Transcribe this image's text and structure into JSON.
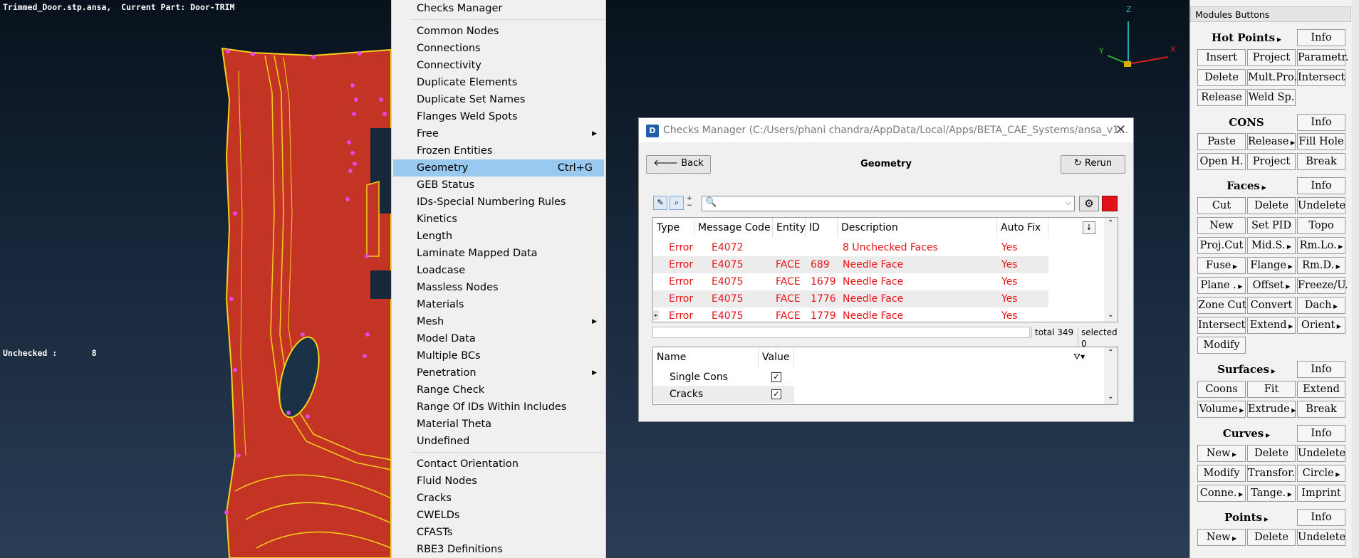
{
  "viewport": {
    "title": "Trimmed_Door.stp.ansa,  Current Part: Door-TRIM",
    "status": "Unchecked :       8",
    "axis": {
      "x": "X",
      "y": "Y",
      "z": "Z"
    }
  },
  "context_menu": {
    "items": [
      {
        "label": "Checks Manager"
      },
      {
        "separator": true
      },
      {
        "label": "Common Nodes"
      },
      {
        "label": "Connections"
      },
      {
        "label": "Connectivity"
      },
      {
        "label": "Duplicate Elements"
      },
      {
        "label": "Duplicate Set Names"
      },
      {
        "label": "Flanges Weld Spots"
      },
      {
        "label": "Free",
        "submenu": true
      },
      {
        "label": "Frozen Entities"
      },
      {
        "label": "Geometry",
        "shortcut": "Ctrl+G",
        "highlighted": true
      },
      {
        "label": "GEB Status"
      },
      {
        "label": "IDs-Special Numbering Rules"
      },
      {
        "label": "Kinetics"
      },
      {
        "label": "Length"
      },
      {
        "label": "Laminate Mapped Data"
      },
      {
        "label": "Loadcase"
      },
      {
        "label": "Massless Nodes"
      },
      {
        "label": "Materials"
      },
      {
        "label": "Mesh",
        "submenu": true
      },
      {
        "label": "Model Data"
      },
      {
        "label": "Multiple BCs"
      },
      {
        "label": "Penetration",
        "submenu": true
      },
      {
        "label": "Range Check"
      },
      {
        "label": "Range Of IDs Within Includes"
      },
      {
        "label": "Material Theta"
      },
      {
        "label": "Undefined"
      },
      {
        "separator": true
      },
      {
        "label": "Contact Orientation"
      },
      {
        "label": "Fluid Nodes"
      },
      {
        "label": "Cracks"
      },
      {
        "label": "CWELDs"
      },
      {
        "label": "CFASTs"
      },
      {
        "label": "RBE3 Definitions"
      }
    ]
  },
  "checks_dialog": {
    "title": "Checks Manager (C:/Users/phani chandra/AppData/Local/Apps/BETA_CAE_Systems/ansa_v1...",
    "logo_text": "D",
    "back_label": "Back",
    "rerun_label": "Rerun",
    "heading": "Geometry",
    "filter_value": "",
    "columns": [
      "Type",
      "Message Code",
      "Entity",
      "ID",
      "Description",
      "Auto Fix"
    ],
    "rows": [
      {
        "type": "Error",
        "code": "E4072",
        "entity": "",
        "id": "",
        "description": "8 Unchecked Faces",
        "autofix": "Yes"
      },
      {
        "type": "Error",
        "code": "E4075",
        "entity": "FACE",
        "id": "689",
        "description": "Needle Face",
        "autofix": "Yes"
      },
      {
        "type": "Error",
        "code": "E4075",
        "entity": "FACE",
        "id": "1679",
        "description": "Needle Face",
        "autofix": "Yes"
      },
      {
        "type": "Error",
        "code": "E4075",
        "entity": "FACE",
        "id": "1776",
        "description": "Needle Face",
        "autofix": "Yes"
      },
      {
        "type": "Error",
        "code": "E4075",
        "entity": "FACE",
        "id": "1779",
        "description": "Needle Face",
        "autofix": "Yes"
      }
    ],
    "total_label": "total 349",
    "selected_label": "selected 0",
    "options_columns": [
      "Name",
      "Value"
    ],
    "options": [
      {
        "name": "Single Cons",
        "checked": true
      },
      {
        "name": "Cracks",
        "checked": true
      }
    ],
    "error_color": "#e8141a"
  },
  "modules": {
    "header": "Modules Buttons",
    "groups": {
      "hot_points": "Hot Points",
      "cons": "CONS",
      "faces": "Faces",
      "surfaces": "Surfaces",
      "curves": "Curves",
      "points": "Points"
    },
    "info_label": "Info",
    "buttons": {
      "hp_insert": "Insert",
      "hp_project": "Project",
      "hp_parametr": "Parametr.",
      "hp_delete": "Delete",
      "hp_multpro": "Mult.Pro.",
      "hp_intersect": "Intersect",
      "hp_release": "Release",
      "hp_weldsp": "Weld Sp.",
      "cons_paste": "Paste",
      "cons_release": "Release",
      "cons_fillhole": "Fill Hole",
      "cons_openh": "Open H.",
      "cons_project": "Project",
      "cons_break": "Break",
      "f_cut": "Cut",
      "f_delete": "Delete",
      "f_undelete": "Undelete",
      "f_new": "New",
      "f_setpid": "Set PID",
      "f_topo": "Topo",
      "f_projcut": "Proj.Cut",
      "f_mids": "Mid.S.",
      "f_rmlo": "Rm.Lo.",
      "f_fuse": "Fuse",
      "f_flange": "Flange",
      "f_rmd": "Rm.D.",
      "f_plane": "Plane .",
      "f_offset": "Offset",
      "f_freeze": "Freeze/U.",
      "f_zonecut": "Zone Cut",
      "f_convert": "Convert",
      "f_dach": "Dach",
      "f_intersect": "Intersect",
      "f_extend": "Extend",
      "f_orient": "Orient",
      "f_modify": "Modify",
      "s_coons": "Coons",
      "s_fit": "Fit",
      "s_extend": "Extend",
      "s_volume": "Volume",
      "s_extrude": "Extrude",
      "s_break": "Break",
      "c_new": "New",
      "c_delete": "Delete",
      "c_undelete": "Undelete",
      "c_modify": "Modify",
      "c_transfor": "Transfor.",
      "c_circle": "Circle",
      "c_conne": "Conne.",
      "c_tange": "Tange.",
      "c_imprint": "Imprint",
      "p_new": "New",
      "p_delete": "Delete",
      "p_undelete": "Undelete"
    }
  }
}
